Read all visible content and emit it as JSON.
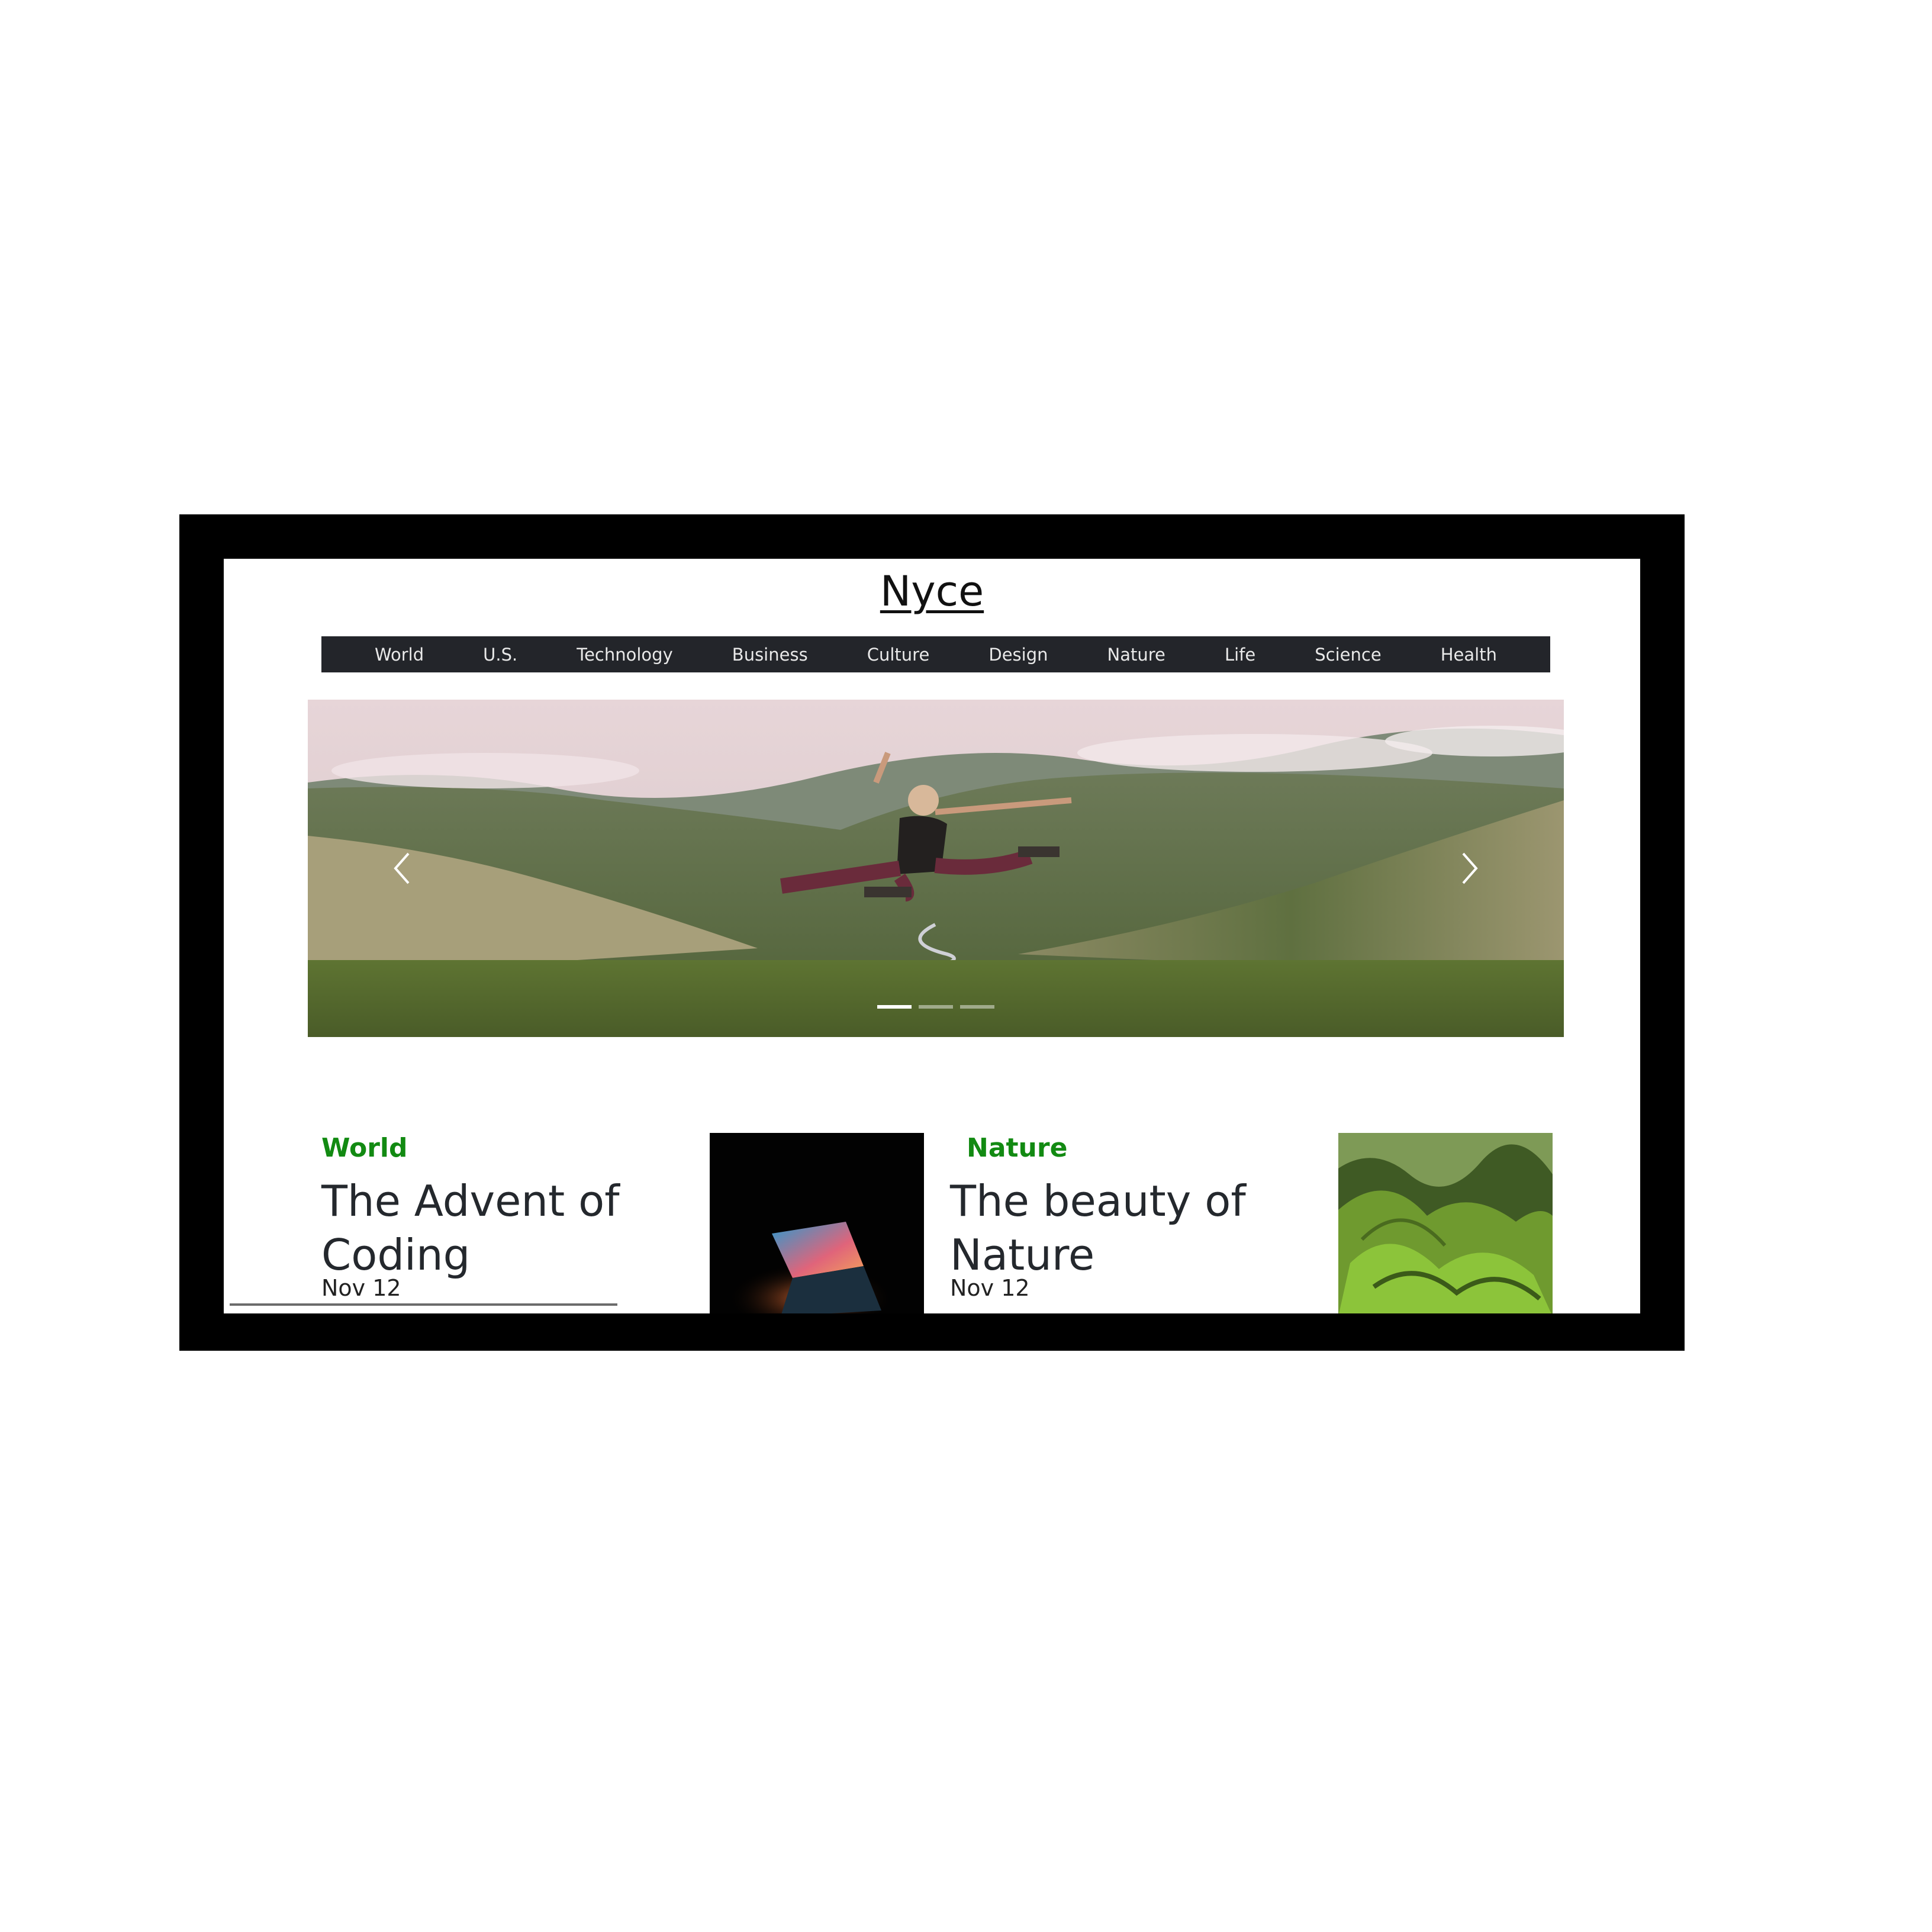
{
  "site": {
    "brand": "Nyce"
  },
  "nav": {
    "items": [
      "World",
      "U.S.",
      "Technology",
      "Business",
      "Culture",
      "Design",
      "Nature",
      "Life",
      "Science",
      "Health"
    ]
  },
  "hero": {
    "prev_icon": "chevron-left",
    "next_icon": "chevron-right",
    "slide_count": 3,
    "active_slide": 1
  },
  "articles": [
    {
      "category": "World",
      "headline": "The Advent of Coding",
      "date": "Nov 12",
      "thumbnail": "laptop-image"
    },
    {
      "category": "Nature",
      "headline": "The beauty of Nature",
      "date": "Nov 12",
      "thumbnail": "green-mountains-image"
    }
  ],
  "colors": {
    "nav_bg": "#23252a",
    "category": "#128a12",
    "frame": "#000000"
  }
}
